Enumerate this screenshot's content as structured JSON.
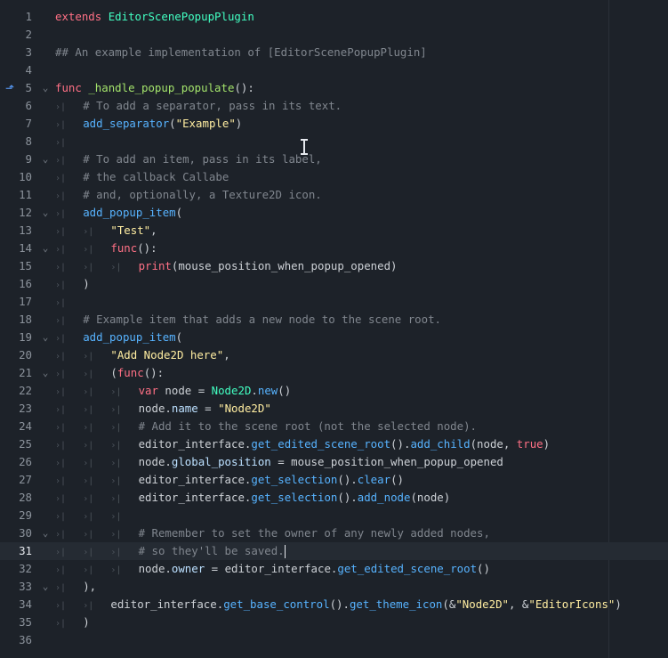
{
  "editor": {
    "current_line": 31,
    "gutter_marker_line": 5,
    "gutter_marker_icon": "override-arrow-icon",
    "colors": {
      "background": "#1d2229",
      "current_line": "#252b33",
      "keyword": "#ff7085",
      "class": "#42ffc2",
      "comment": "#80868e",
      "function": "#57b3ff",
      "string": "#ffeda1"
    },
    "lines": [
      {
        "n": 1,
        "fold": false,
        "tabs": 0,
        "tokens": [
          [
            "kw",
            "extends"
          ],
          [
            "id",
            " "
          ],
          [
            "cls",
            "EditorScenePopupPlugin"
          ]
        ]
      },
      {
        "n": 2,
        "fold": false,
        "tabs": 0,
        "tokens": []
      },
      {
        "n": 3,
        "fold": false,
        "tabs": 0,
        "tokens": [
          [
            "cm",
            "## An example implementation of [EditorScenePopupPlugin]"
          ]
        ]
      },
      {
        "n": 4,
        "fold": false,
        "tabs": 0,
        "tokens": []
      },
      {
        "n": 5,
        "fold": true,
        "tabs": 0,
        "tokens": [
          [
            "kw",
            "func"
          ],
          [
            "id",
            " "
          ],
          [
            "def",
            "_handle_popup_populate"
          ],
          [
            "id",
            "():"
          ]
        ]
      },
      {
        "n": 6,
        "fold": false,
        "tabs": 1,
        "tokens": [
          [
            "cm",
            "# To add a separator, pass in its text."
          ]
        ]
      },
      {
        "n": 7,
        "fold": false,
        "tabs": 1,
        "tokens": [
          [
            "fn",
            "add_separator"
          ],
          [
            "id",
            "("
          ],
          [
            "str",
            "\"Example\""
          ],
          [
            "id",
            ")"
          ]
        ]
      },
      {
        "n": 8,
        "fold": false,
        "tabs": 1,
        "tokens": []
      },
      {
        "n": 9,
        "fold": true,
        "tabs": 1,
        "tokens": [
          [
            "cm",
            "# To add an item, pass in its label,"
          ]
        ]
      },
      {
        "n": 10,
        "fold": false,
        "tabs": 1,
        "tokens": [
          [
            "cm",
            "# the callback Callabe"
          ]
        ]
      },
      {
        "n": 11,
        "fold": false,
        "tabs": 1,
        "tokens": [
          [
            "cm",
            "# and, optionally, a Texture2D icon."
          ]
        ]
      },
      {
        "n": 12,
        "fold": true,
        "tabs": 1,
        "tokens": [
          [
            "fn",
            "add_popup_item"
          ],
          [
            "id",
            "("
          ]
        ]
      },
      {
        "n": 13,
        "fold": false,
        "tabs": 2,
        "tokens": [
          [
            "str",
            "\"Test\""
          ],
          [
            "id",
            ","
          ]
        ]
      },
      {
        "n": 14,
        "fold": true,
        "tabs": 2,
        "tokens": [
          [
            "kw",
            "func"
          ],
          [
            "id",
            "():"
          ]
        ]
      },
      {
        "n": 15,
        "fold": false,
        "tabs": 3,
        "tokens": [
          [
            "kw",
            "print"
          ],
          [
            "id",
            "(mouse_position_when_popup_opened)"
          ]
        ]
      },
      {
        "n": 16,
        "fold": false,
        "tabs": 1,
        "tokens": [
          [
            "id",
            ")"
          ]
        ]
      },
      {
        "n": 17,
        "fold": false,
        "tabs": 1,
        "tokens": []
      },
      {
        "n": 18,
        "fold": false,
        "tabs": 1,
        "tokens": [
          [
            "cm",
            "# Example item that adds a new node to the scene root."
          ]
        ]
      },
      {
        "n": 19,
        "fold": true,
        "tabs": 1,
        "tokens": [
          [
            "fn",
            "add_popup_item"
          ],
          [
            "id",
            "("
          ]
        ]
      },
      {
        "n": 20,
        "fold": false,
        "tabs": 2,
        "tokens": [
          [
            "str",
            "\"Add Node2D here\""
          ],
          [
            "id",
            ","
          ]
        ]
      },
      {
        "n": 21,
        "fold": true,
        "tabs": 2,
        "tokens": [
          [
            "id",
            "("
          ],
          [
            "kw",
            "func"
          ],
          [
            "id",
            "():"
          ]
        ]
      },
      {
        "n": 22,
        "fold": false,
        "tabs": 3,
        "tokens": [
          [
            "kw",
            "var"
          ],
          [
            "id",
            " node = "
          ],
          [
            "cls",
            "Node2D"
          ],
          [
            "id",
            "."
          ],
          [
            "fn",
            "new"
          ],
          [
            "id",
            "()"
          ]
        ]
      },
      {
        "n": 23,
        "fold": false,
        "tabs": 3,
        "tokens": [
          [
            "id",
            "node."
          ],
          [
            "prop",
            "name"
          ],
          [
            "id",
            " = "
          ],
          [
            "str",
            "\"Node2D\""
          ]
        ]
      },
      {
        "n": 24,
        "fold": false,
        "tabs": 3,
        "tokens": [
          [
            "cm",
            "# Add it to the scene root (not the selected node)."
          ]
        ]
      },
      {
        "n": 25,
        "fold": false,
        "tabs": 3,
        "tokens": [
          [
            "id",
            "editor_interface."
          ],
          [
            "fn",
            "get_edited_scene_root"
          ],
          [
            "id",
            "()."
          ],
          [
            "fn",
            "add_child"
          ],
          [
            "id",
            "(node, "
          ],
          [
            "bool",
            "true"
          ],
          [
            "id",
            ")"
          ]
        ]
      },
      {
        "n": 26,
        "fold": false,
        "tabs": 3,
        "tokens": [
          [
            "id",
            "node."
          ],
          [
            "prop",
            "global_position"
          ],
          [
            "id",
            " = mouse_position_when_popup_opened"
          ]
        ]
      },
      {
        "n": 27,
        "fold": false,
        "tabs": 3,
        "tokens": [
          [
            "id",
            "editor_interface."
          ],
          [
            "fn",
            "get_selection"
          ],
          [
            "id",
            "()."
          ],
          [
            "fn",
            "clear"
          ],
          [
            "id",
            "()"
          ]
        ]
      },
      {
        "n": 28,
        "fold": false,
        "tabs": 3,
        "tokens": [
          [
            "id",
            "editor_interface."
          ],
          [
            "fn",
            "get_selection"
          ],
          [
            "id",
            "()."
          ],
          [
            "fn",
            "add_node"
          ],
          [
            "id",
            "(node)"
          ]
        ]
      },
      {
        "n": 29,
        "fold": false,
        "tabs": 3,
        "tokens": []
      },
      {
        "n": 30,
        "fold": true,
        "tabs": 3,
        "tokens": [
          [
            "cm",
            "# Remember to set the owner of any newly added nodes,"
          ]
        ]
      },
      {
        "n": 31,
        "fold": false,
        "tabs": 3,
        "tokens": [
          [
            "cm",
            "# so they'll be saved."
          ]
        ],
        "caret": true
      },
      {
        "n": 32,
        "fold": false,
        "tabs": 3,
        "tokens": [
          [
            "id",
            "node."
          ],
          [
            "prop",
            "owner"
          ],
          [
            "id",
            " = editor_interface."
          ],
          [
            "fn",
            "get_edited_scene_root"
          ],
          [
            "id",
            "()"
          ]
        ]
      },
      {
        "n": 33,
        "fold": true,
        "tabs": 1,
        "tokens": [
          [
            "id",
            "),"
          ]
        ]
      },
      {
        "n": 34,
        "fold": false,
        "tabs": 2,
        "tokens": [
          [
            "id",
            "editor_interface."
          ],
          [
            "fn",
            "get_base_control"
          ],
          [
            "id",
            "()."
          ],
          [
            "fn",
            "get_theme_icon"
          ],
          [
            "id",
            "(&"
          ],
          [
            "str",
            "\"Node2D\""
          ],
          [
            "id",
            ", &"
          ],
          [
            "str",
            "\"EditorIcons\""
          ],
          [
            "id",
            ")"
          ]
        ]
      },
      {
        "n": 35,
        "fold": false,
        "tabs": 1,
        "tokens": [
          [
            "id",
            ")"
          ]
        ]
      },
      {
        "n": 36,
        "fold": false,
        "tabs": 0,
        "tokens": []
      }
    ]
  }
}
